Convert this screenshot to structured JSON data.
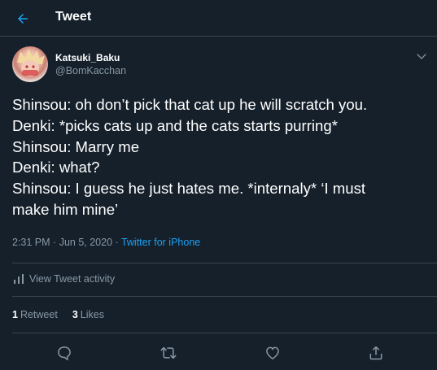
{
  "header": {
    "title": "Tweet",
    "back_icon": "arrow-left-icon",
    "accent": "#1da1f2"
  },
  "tweet": {
    "display_name": "Katsuki_Baku",
    "handle": "@BomKacchan",
    "text": "Shinsou: oh don’t pick that cat up he will scratch you.\nDenki: *picks cats up and the cats starts purring*\nShinsou: Marry me\nDenki: what?\nShinsou: I guess he just hates me. *internaly* ‘I must\nmake him mine’",
    "time": "2:31 PM",
    "separator": "·",
    "date": "Jun 5, 2020",
    "source": "Twitter for iPhone"
  },
  "activity": {
    "label": "View Tweet activity",
    "icon": "bar-chart-icon"
  },
  "stats": {
    "retweets_count": "1",
    "retweets_label": "Retweet",
    "likes_count": "3",
    "likes_label": "Likes"
  },
  "actions": {
    "reply_icon": "reply-icon",
    "retweet_icon": "retweet-icon",
    "like_icon": "heart-icon",
    "share_icon": "share-icon"
  },
  "colors": {
    "background": "#15202b",
    "secondary_text": "#8899a6",
    "divider": "#38444d",
    "link": "#1da1f2"
  }
}
